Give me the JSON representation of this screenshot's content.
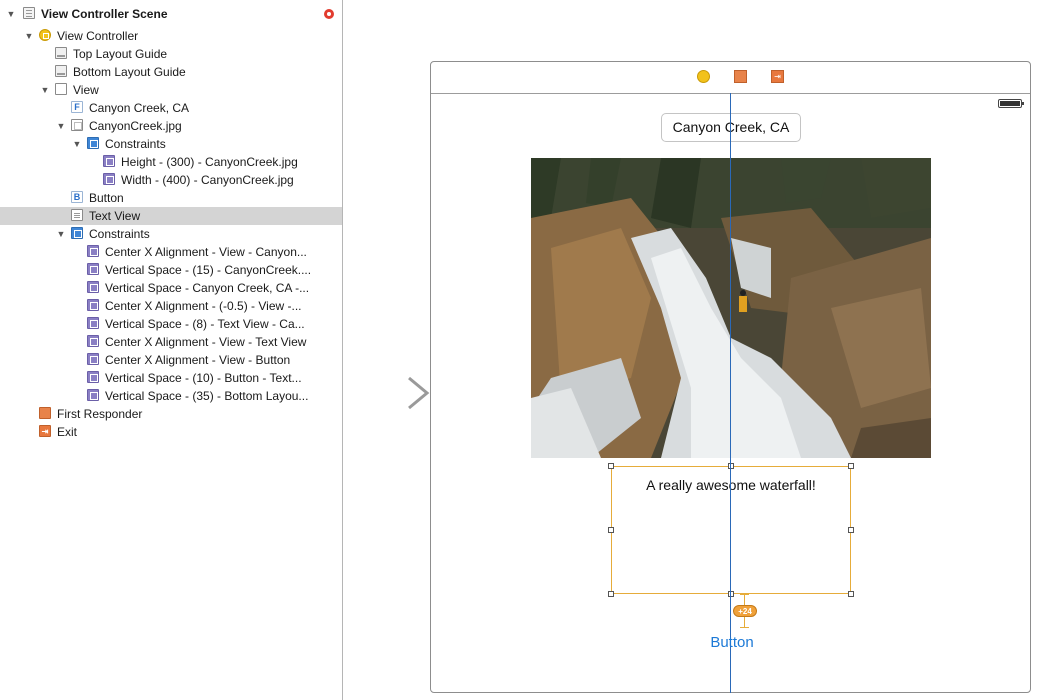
{
  "outline": {
    "scene_title": "View Controller Scene",
    "items": [
      {
        "label": "View Controller Scene",
        "icon": "scene-icon"
      },
      {
        "label": "View Controller",
        "icon": "view-controller-icon"
      },
      {
        "label": "Top Layout Guide",
        "icon": "layout-guide-icon"
      },
      {
        "label": "Bottom Layout Guide",
        "icon": "layout-guide-icon"
      },
      {
        "label": "View",
        "icon": "view-icon"
      },
      {
        "label": "Canyon Creek, CA",
        "icon": "label-icon",
        "glyph": "F"
      },
      {
        "label": "CanyonCreek.jpg",
        "icon": "image-view-icon"
      },
      {
        "label": "Constraints",
        "icon": "constraints-group-icon"
      },
      {
        "label": "Height - (300) - CanyonCreek.jpg",
        "icon": "constraint-icon"
      },
      {
        "label": "Width - (400) - CanyonCreek.jpg",
        "icon": "constraint-icon"
      },
      {
        "label": "Button",
        "icon": "button-icon",
        "glyph": "B"
      },
      {
        "label": "Text View",
        "icon": "text-view-icon",
        "selected": true
      },
      {
        "label": "Constraints",
        "icon": "constraints-group-icon"
      },
      {
        "label": "Center X Alignment - View - Canyon...",
        "icon": "constraint-icon"
      },
      {
        "label": "Vertical Space - (15) - CanyonCreek....",
        "icon": "constraint-icon"
      },
      {
        "label": "Vertical Space - Canyon Creek, CA -...",
        "icon": "constraint-icon"
      },
      {
        "label": "Center X Alignment - (-0.5) - View -...",
        "icon": "constraint-icon"
      },
      {
        "label": "Vertical Space - (8) - Text View - Ca...",
        "icon": "constraint-icon"
      },
      {
        "label": "Center X Alignment - View - Text View",
        "icon": "constraint-icon"
      },
      {
        "label": "Center X Alignment - View - Button",
        "icon": "constraint-icon"
      },
      {
        "label": "Vertical Space - (10) - Button - Text...",
        "icon": "constraint-icon"
      },
      {
        "label": "Vertical Space - (35) - Bottom Layou...",
        "icon": "constraint-icon"
      },
      {
        "label": "First Responder",
        "icon": "first-responder-icon"
      },
      {
        "label": "Exit",
        "icon": "exit-icon"
      }
    ]
  },
  "scene": {
    "title_label": "Canyon Creek, CA",
    "text_view": "A really awesome waterfall!",
    "button_label": "Button",
    "constraint_badge": "+24",
    "dock_icons": [
      "view-controller-icon",
      "first-responder-icon",
      "exit-icon"
    ]
  },
  "colors": {
    "selection": "#d4d4d4",
    "accent_blue": "#1c79d6",
    "constraint_orange": "#e6ac3a",
    "guide_blue": "#2a69b8",
    "vc_yellow": "#f2c21b",
    "exit_orange": "#e8783e"
  }
}
